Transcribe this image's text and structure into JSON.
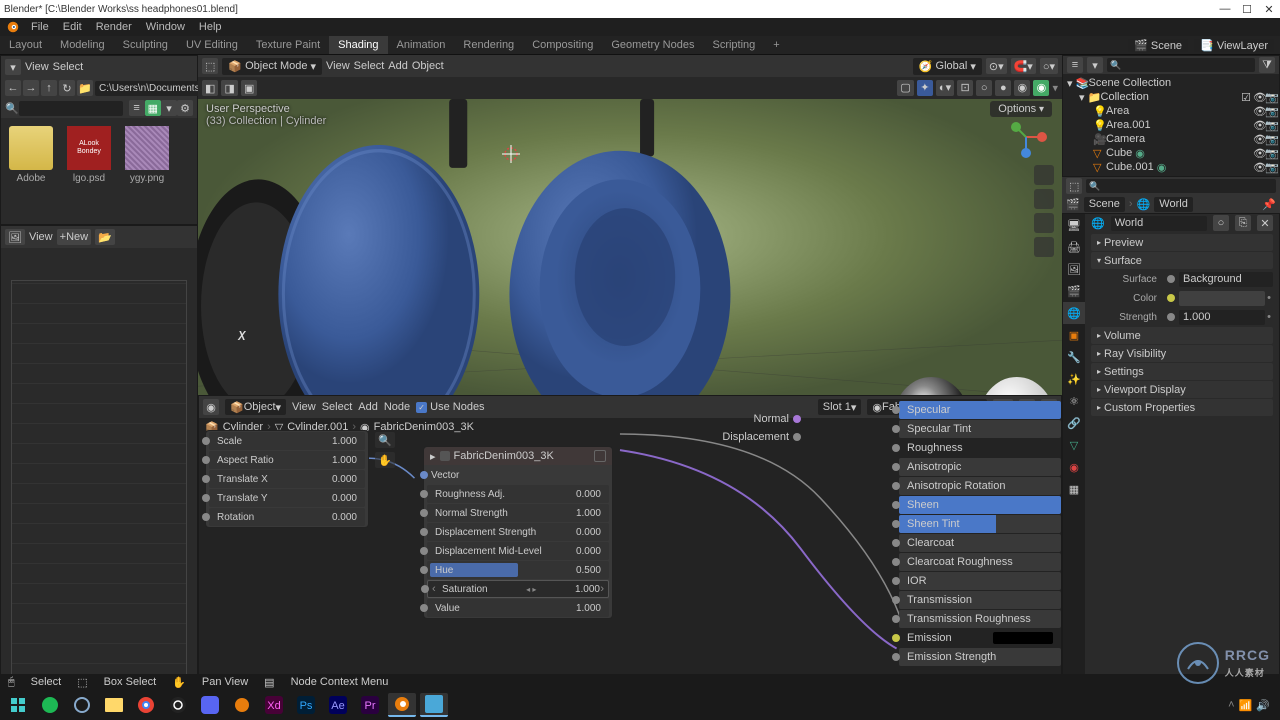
{
  "titlebar": {
    "text": "Blender* [C:\\Blender Works\\ss headphones01.blend]"
  },
  "menubar": [
    "File",
    "Edit",
    "Render",
    "Window",
    "Help"
  ],
  "workspaces": [
    "Layout",
    "Modeling",
    "Sculpting",
    "UV Editing",
    "Texture Paint",
    "Shading",
    "Animation",
    "Rendering",
    "Compositing",
    "Geometry Nodes",
    "Scripting"
  ],
  "active_workspace": "Shading",
  "scene": {
    "scene_label": "Scene",
    "layer_label": "ViewLayer"
  },
  "filebrowser": {
    "path": "C:\\Users\\n\\Documents\\",
    "thumbs": [
      {
        "name": "Adobe",
        "kind": "folder"
      },
      {
        "name": "lgo.psd",
        "kind": "red"
      },
      {
        "name": "ygy.png",
        "kind": "tex"
      }
    ]
  },
  "viewport": {
    "mode": "Object Mode",
    "menu": [
      "View",
      "Select",
      "Add",
      "Object"
    ],
    "orient": "Global",
    "persp_l1": "User Perspective",
    "persp_l2": "(33) Collection | Cylinder",
    "options": "Options"
  },
  "outliner": {
    "root": "Scene Collection",
    "coll": "Collection",
    "items": [
      "Area",
      "Area.001",
      "Camera",
      "Cube",
      "Cube.001"
    ]
  },
  "props": {
    "scene_label": "Scene",
    "world_label": "World",
    "world_name": "World",
    "sections": [
      "Preview",
      "Surface",
      "Volume",
      "Ray Visibility",
      "Settings",
      "Viewport Display",
      "Custom Properties"
    ],
    "surface": {
      "label": "Surface",
      "value": "Background"
    },
    "color": {
      "label": "Color"
    },
    "strength": {
      "label": "Strength",
      "value": "1.000"
    }
  },
  "node_editor": {
    "menu": [
      "View",
      "Select",
      "Add",
      "Node"
    ],
    "object_dd": "Object",
    "use_nodes": "Use Nodes",
    "slot": "Slot 1",
    "material": "FabricDenim003_3K",
    "view_menu": "View",
    "left_menu": [
      "View",
      "Select"
    ],
    "new": "New",
    "crumb": [
      "Cylinder",
      "Cylinder.001",
      "FabricDenim003_3K"
    ],
    "mapping": {
      "rows": [
        {
          "name": "Scale",
          "value": "1.000"
        },
        {
          "name": "Aspect Ratio",
          "value": "1.000"
        },
        {
          "name": "Translate X",
          "value": "0.000"
        },
        {
          "name": "Translate Y",
          "value": "0.000"
        },
        {
          "name": "Rotation",
          "value": "0.000"
        }
      ]
    },
    "fabric": {
      "vector_out": "Vector",
      "title": "FabricDenim003_3K",
      "rows": [
        {
          "name": "Roughness Adj.",
          "value": "0.000"
        },
        {
          "name": "Normal Strength",
          "value": "1.000"
        },
        {
          "name": "Displacement Strength",
          "value": "0.000"
        },
        {
          "name": "Displacement Mid-Level",
          "value": "0.000"
        },
        {
          "name": "Hue",
          "value": "0.500"
        },
        {
          "name": "Saturation",
          "value": "1.000",
          "sel": true
        },
        {
          "name": "Value",
          "value": "1.000"
        }
      ]
    },
    "outputs": {
      "normal": "Normal",
      "disp": "Displacement"
    },
    "bsdf": [
      {
        "name": "Specular",
        "hl": true
      },
      {
        "name": "Specular Tint"
      },
      {
        "name": "Roughness"
      },
      {
        "name": "Anisotropic"
      },
      {
        "name": "Anisotropic Rotation"
      },
      {
        "name": "Sheen",
        "hl": true
      },
      {
        "name": "Sheen Tint",
        "hl": true,
        "half": true
      },
      {
        "name": "Clearcoat"
      },
      {
        "name": "Clearcoat Roughness"
      },
      {
        "name": "IOR"
      },
      {
        "name": "Transmission"
      },
      {
        "name": "Transmission Roughness"
      },
      {
        "name": "Emission",
        "y": true
      },
      {
        "name": "Emission Strength"
      }
    ]
  },
  "status": {
    "select": "Select",
    "box": "Box Select",
    "pan": "Pan View",
    "ctx": "Node Context Menu"
  },
  "taskbar": {
    "time": "",
    "date": ""
  }
}
